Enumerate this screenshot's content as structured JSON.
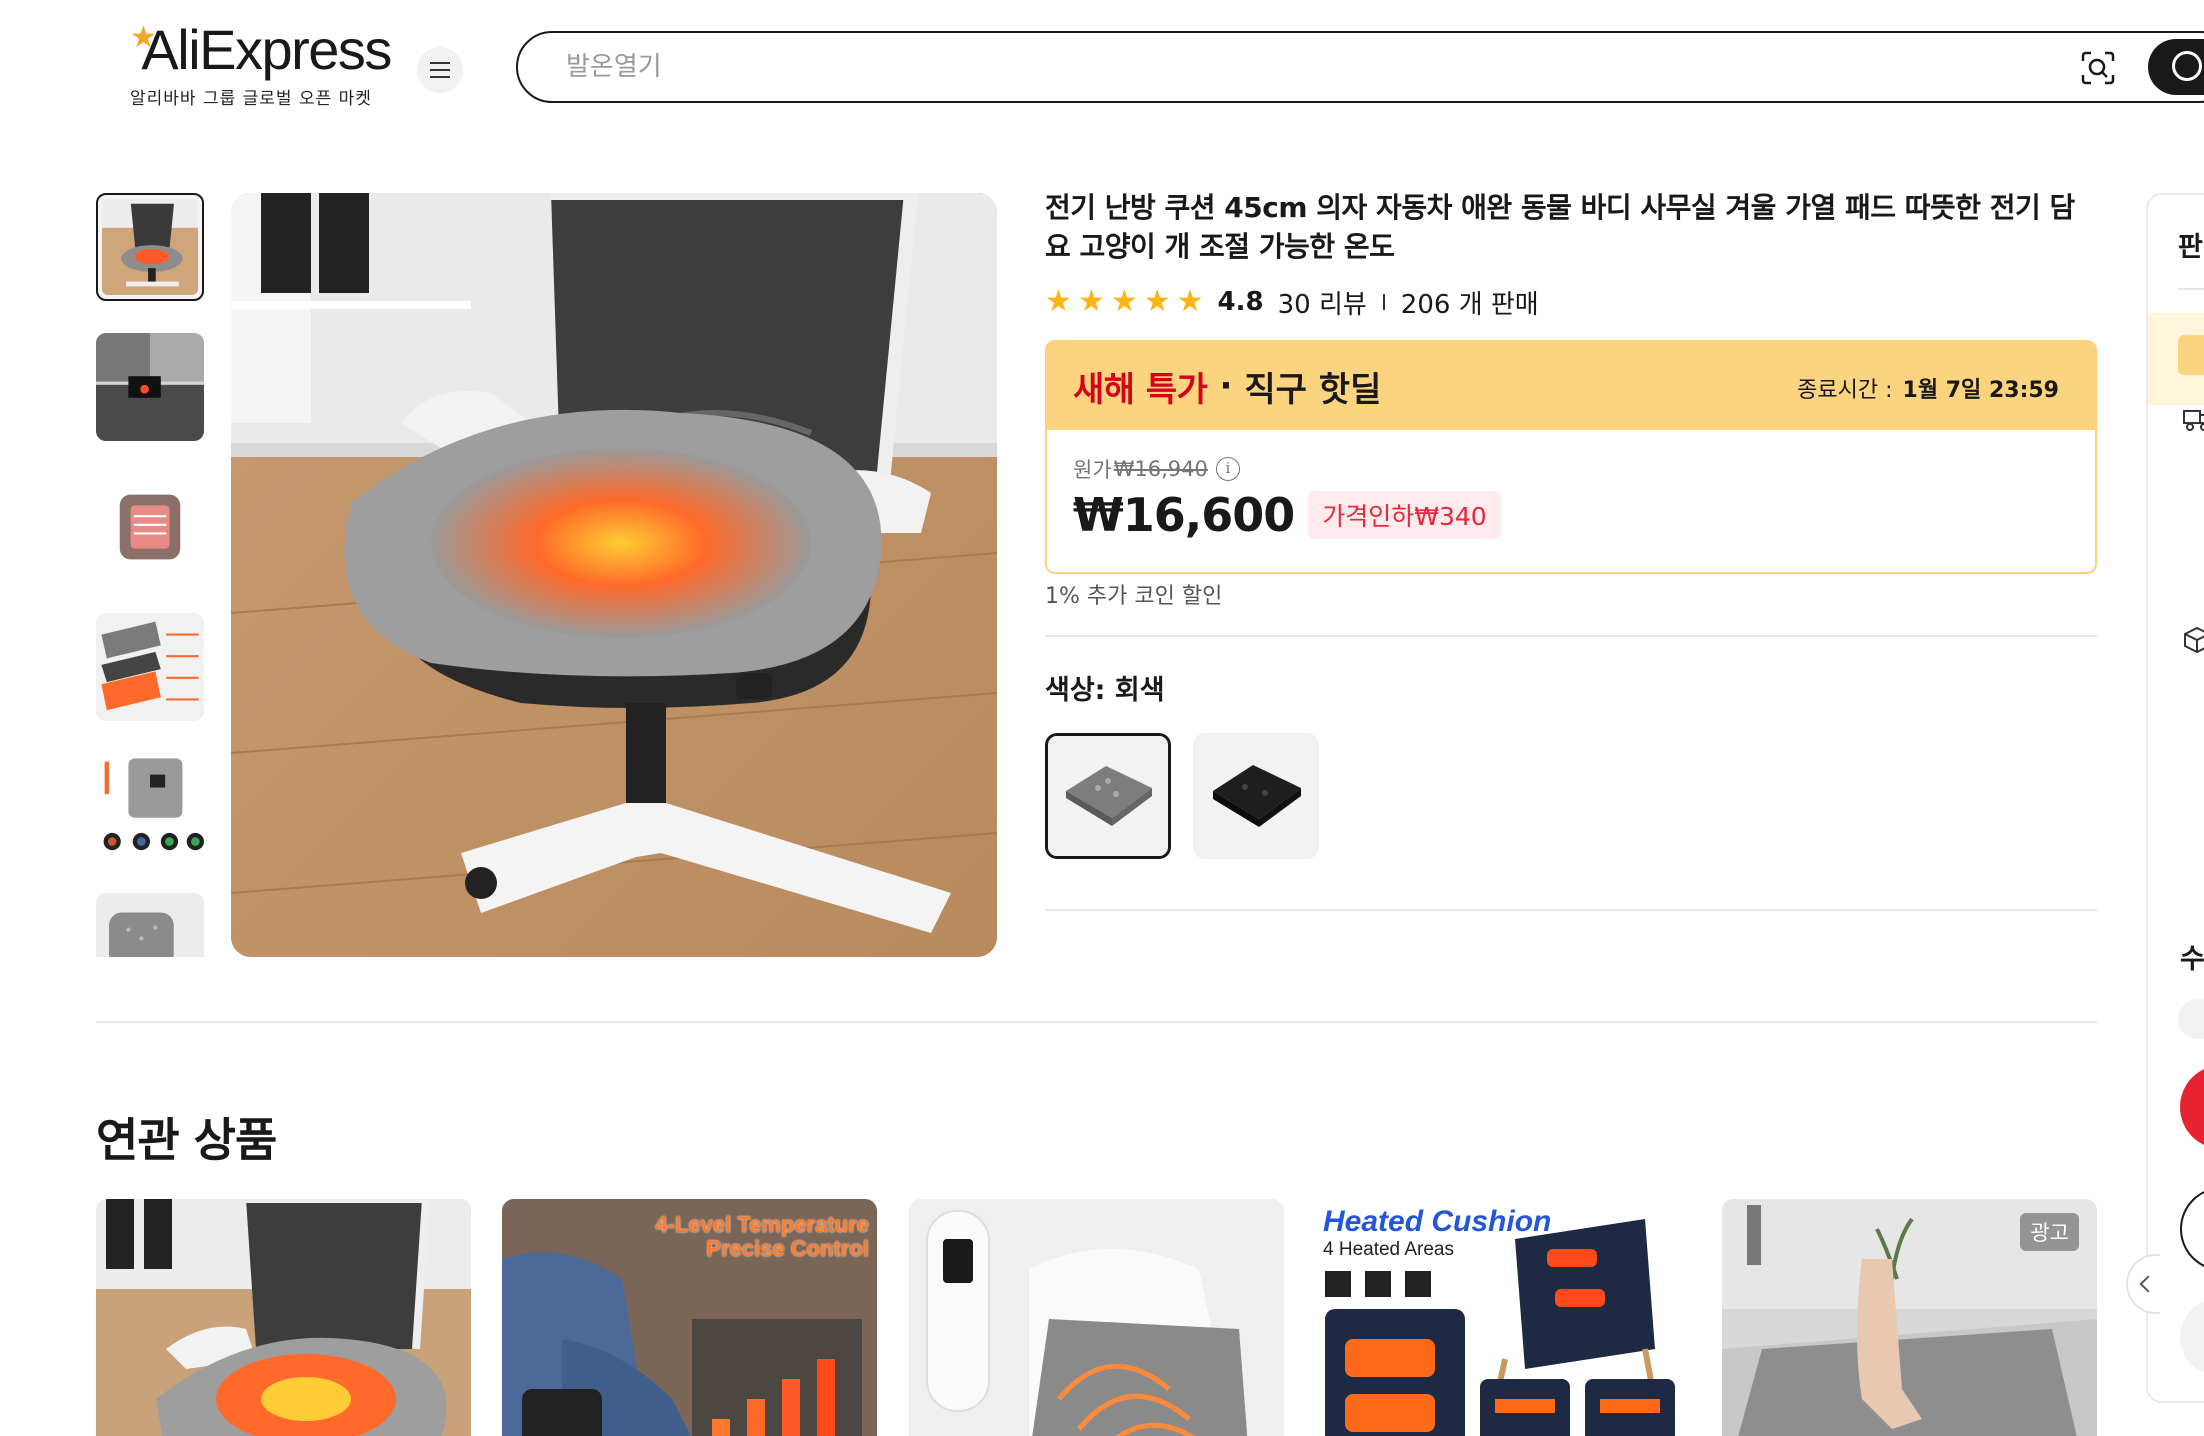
{
  "header": {
    "logo_text": "AliExpress",
    "logo_subtitle": "알리바바 그룹 글로벌 오픈 마켓",
    "search_placeholder": "발온열기"
  },
  "product": {
    "title": "전기 난방 쿠션 45cm 의자 자동차 애완 동물 바디 사무실 겨울 가열 패드 따뜻한 전기 담요 고양이 개 조절 가능한 온도",
    "rating": "4.8",
    "reviews": "30 리뷰",
    "sold": "206 개 판매",
    "deal": {
      "name": "새해 특가",
      "separator": "·",
      "subtitle": "직구 핫딜",
      "end_label": "종료시간 :",
      "end_time": "1월 7일 23:59"
    },
    "original_label": "원가",
    "original_price": "₩16,940",
    "price": "₩16,600",
    "discount": "가격인하₩340",
    "coin_discount": "1% 추가 코인 할인",
    "color_label": "색상: 회색",
    "colors": [
      "회색",
      "검정"
    ],
    "rating_stars": 5
  },
  "side_panel": {
    "heading": "판",
    "qty_label": "수"
  },
  "related": {
    "heading": "연관 상품",
    "cards": [
      {
        "overlay_text": ""
      },
      {
        "overlay_text": "4-Level Temperature Precise Control"
      },
      {
        "overlay_text": ""
      },
      {
        "overlay_text": "Heated Cushion",
        "overlay_sub": "4 Heated Areas"
      },
      {
        "overlay_text": "",
        "badge": "광고"
      }
    ]
  },
  "colors": {
    "accent_red": "#d3031c",
    "deal_yellow": "#fcd480",
    "star": "#fdb515",
    "badge_pink": "#ffebed"
  }
}
